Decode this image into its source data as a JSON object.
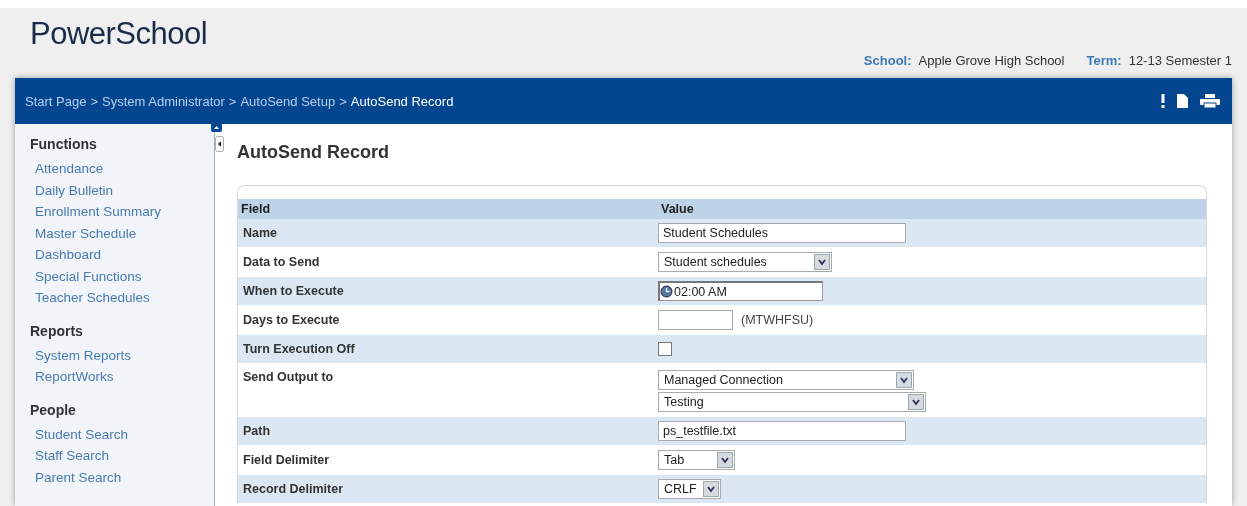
{
  "logo": "PowerSchool",
  "context": [
    {
      "label": "School:",
      "value": "Apple Grove High School"
    },
    {
      "label": "Term:",
      "value": "12-13 Semester 1"
    }
  ],
  "breadcrumb": [
    "Start Page",
    ">",
    "System Administrator",
    ">",
    "AutoSend Setup",
    ">",
    "AutoSend Record"
  ],
  "sidebar": [
    {
      "heading": "Functions",
      "items": [
        "Attendance",
        "Daily Bulletin",
        "Enrollment Summary",
        "Master Schedule",
        "Dashboard",
        "Special Functions",
        "Teacher Schedules"
      ]
    },
    {
      "heading": "Reports",
      "items": [
        "System Reports",
        "ReportWorks"
      ]
    },
    {
      "heading": "People",
      "items": [
        "Student Search",
        "Staff Search",
        "Parent Search"
      ]
    }
  ],
  "page_title": "AutoSend Record",
  "table": {
    "columns": [
      "Field",
      "Value"
    ],
    "rows": [
      {
        "label": "Name",
        "kind": "text",
        "value": "Student Schedules"
      },
      {
        "label": "Data to Send",
        "kind": "select",
        "value": "Student schedules"
      },
      {
        "label": "When to Execute",
        "kind": "time",
        "value": "02:00 AM"
      },
      {
        "label": "Days to Execute",
        "kind": "days",
        "value": "",
        "hint": "(MTWHFSU)"
      },
      {
        "label": "Turn Execution Off",
        "kind": "checkbox",
        "checked": false
      },
      {
        "label": "Send Output to",
        "kind": "selects",
        "values": [
          "Managed Connection",
          "Testing"
        ]
      },
      {
        "label": "Path",
        "kind": "text",
        "value": "ps_testfile.txt"
      },
      {
        "label": "Field Delimiter",
        "kind": "select",
        "value": "Tab"
      },
      {
        "label": "Record Delimiter",
        "kind": "select",
        "value": "CRLF"
      }
    ]
  }
}
